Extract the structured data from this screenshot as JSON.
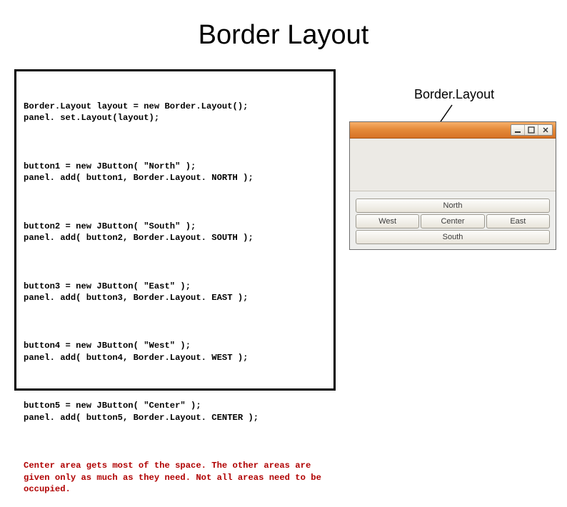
{
  "slide": {
    "title": "Border Layout"
  },
  "code": {
    "b1": "Border.Layout layout = new Border.Layout();\npanel. set.Layout(layout);",
    "b2": "button1 = new JButton( \"North\" );\npanel. add( button1, Border.Layout. NORTH );",
    "b3": "button2 = new JButton( \"South\" );\npanel. add( button2, Border.Layout. SOUTH );",
    "b4": "button3 = new JButton( \"East\" );\npanel. add( button3, Border.Layout. EAST );",
    "b5": "button4 = new JButton( \"West\" );\npanel. add( button4, Border.Layout. WEST );",
    "b6": "button5 = new JButton( \"Center\" );\npanel. add( button5, Border.Layout. CENTER );",
    "footnote": "Center area gets most of the space. The other areas are given only as much as they need. Not all areas need to be occupied."
  },
  "annotation": {
    "label": "Border.Layout"
  },
  "window": {
    "buttons": {
      "north": "North",
      "south": "South",
      "east": "East",
      "west": "West",
      "center": "Center"
    }
  }
}
